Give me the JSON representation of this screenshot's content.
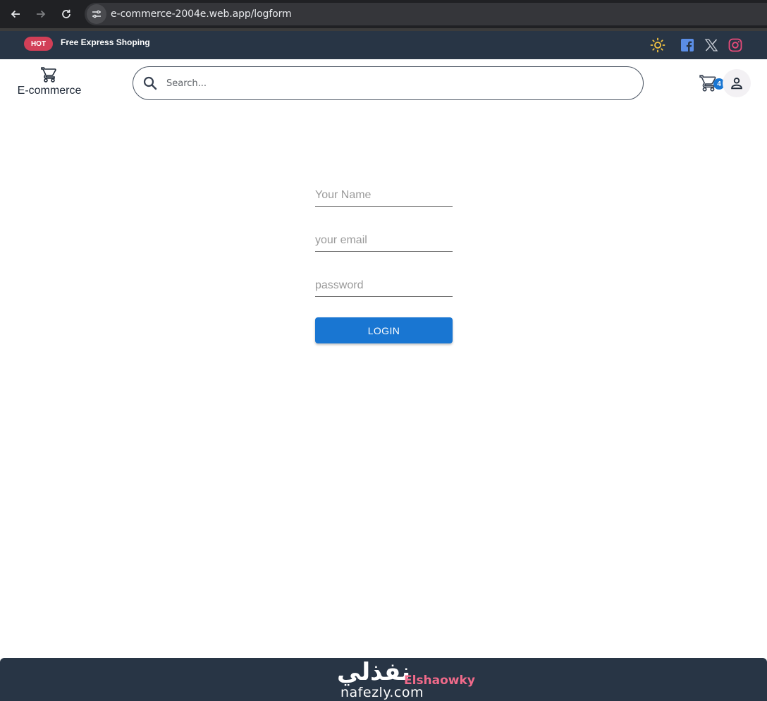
{
  "browser": {
    "url": "e-commerce-2004e.web.app/logform"
  },
  "promo": {
    "badge": "HOT",
    "text": "Free Express Shoping"
  },
  "header": {
    "logo_text": "E-commerce",
    "search_placeholder": "Search...",
    "cart_count": "4"
  },
  "form": {
    "name_placeholder": "Your Name",
    "email_placeholder": "your email",
    "password_placeholder": "password",
    "login_label": "LOGIN"
  },
  "watermark": {
    "arabic": "نفذلي",
    "author": "Elshaowky",
    "domain": "nafezly.com"
  },
  "colors": {
    "promo_bg": "#283545",
    "hot_badge": "#d23f57",
    "primary": "#1976d2",
    "footer_bg": "#283545"
  },
  "icons": {
    "theme": "sun-icon",
    "facebook": "facebook-icon",
    "x": "x-icon",
    "instagram": "instagram-icon",
    "cart": "cart-icon",
    "account": "person-icon",
    "search": "search-icon"
  }
}
